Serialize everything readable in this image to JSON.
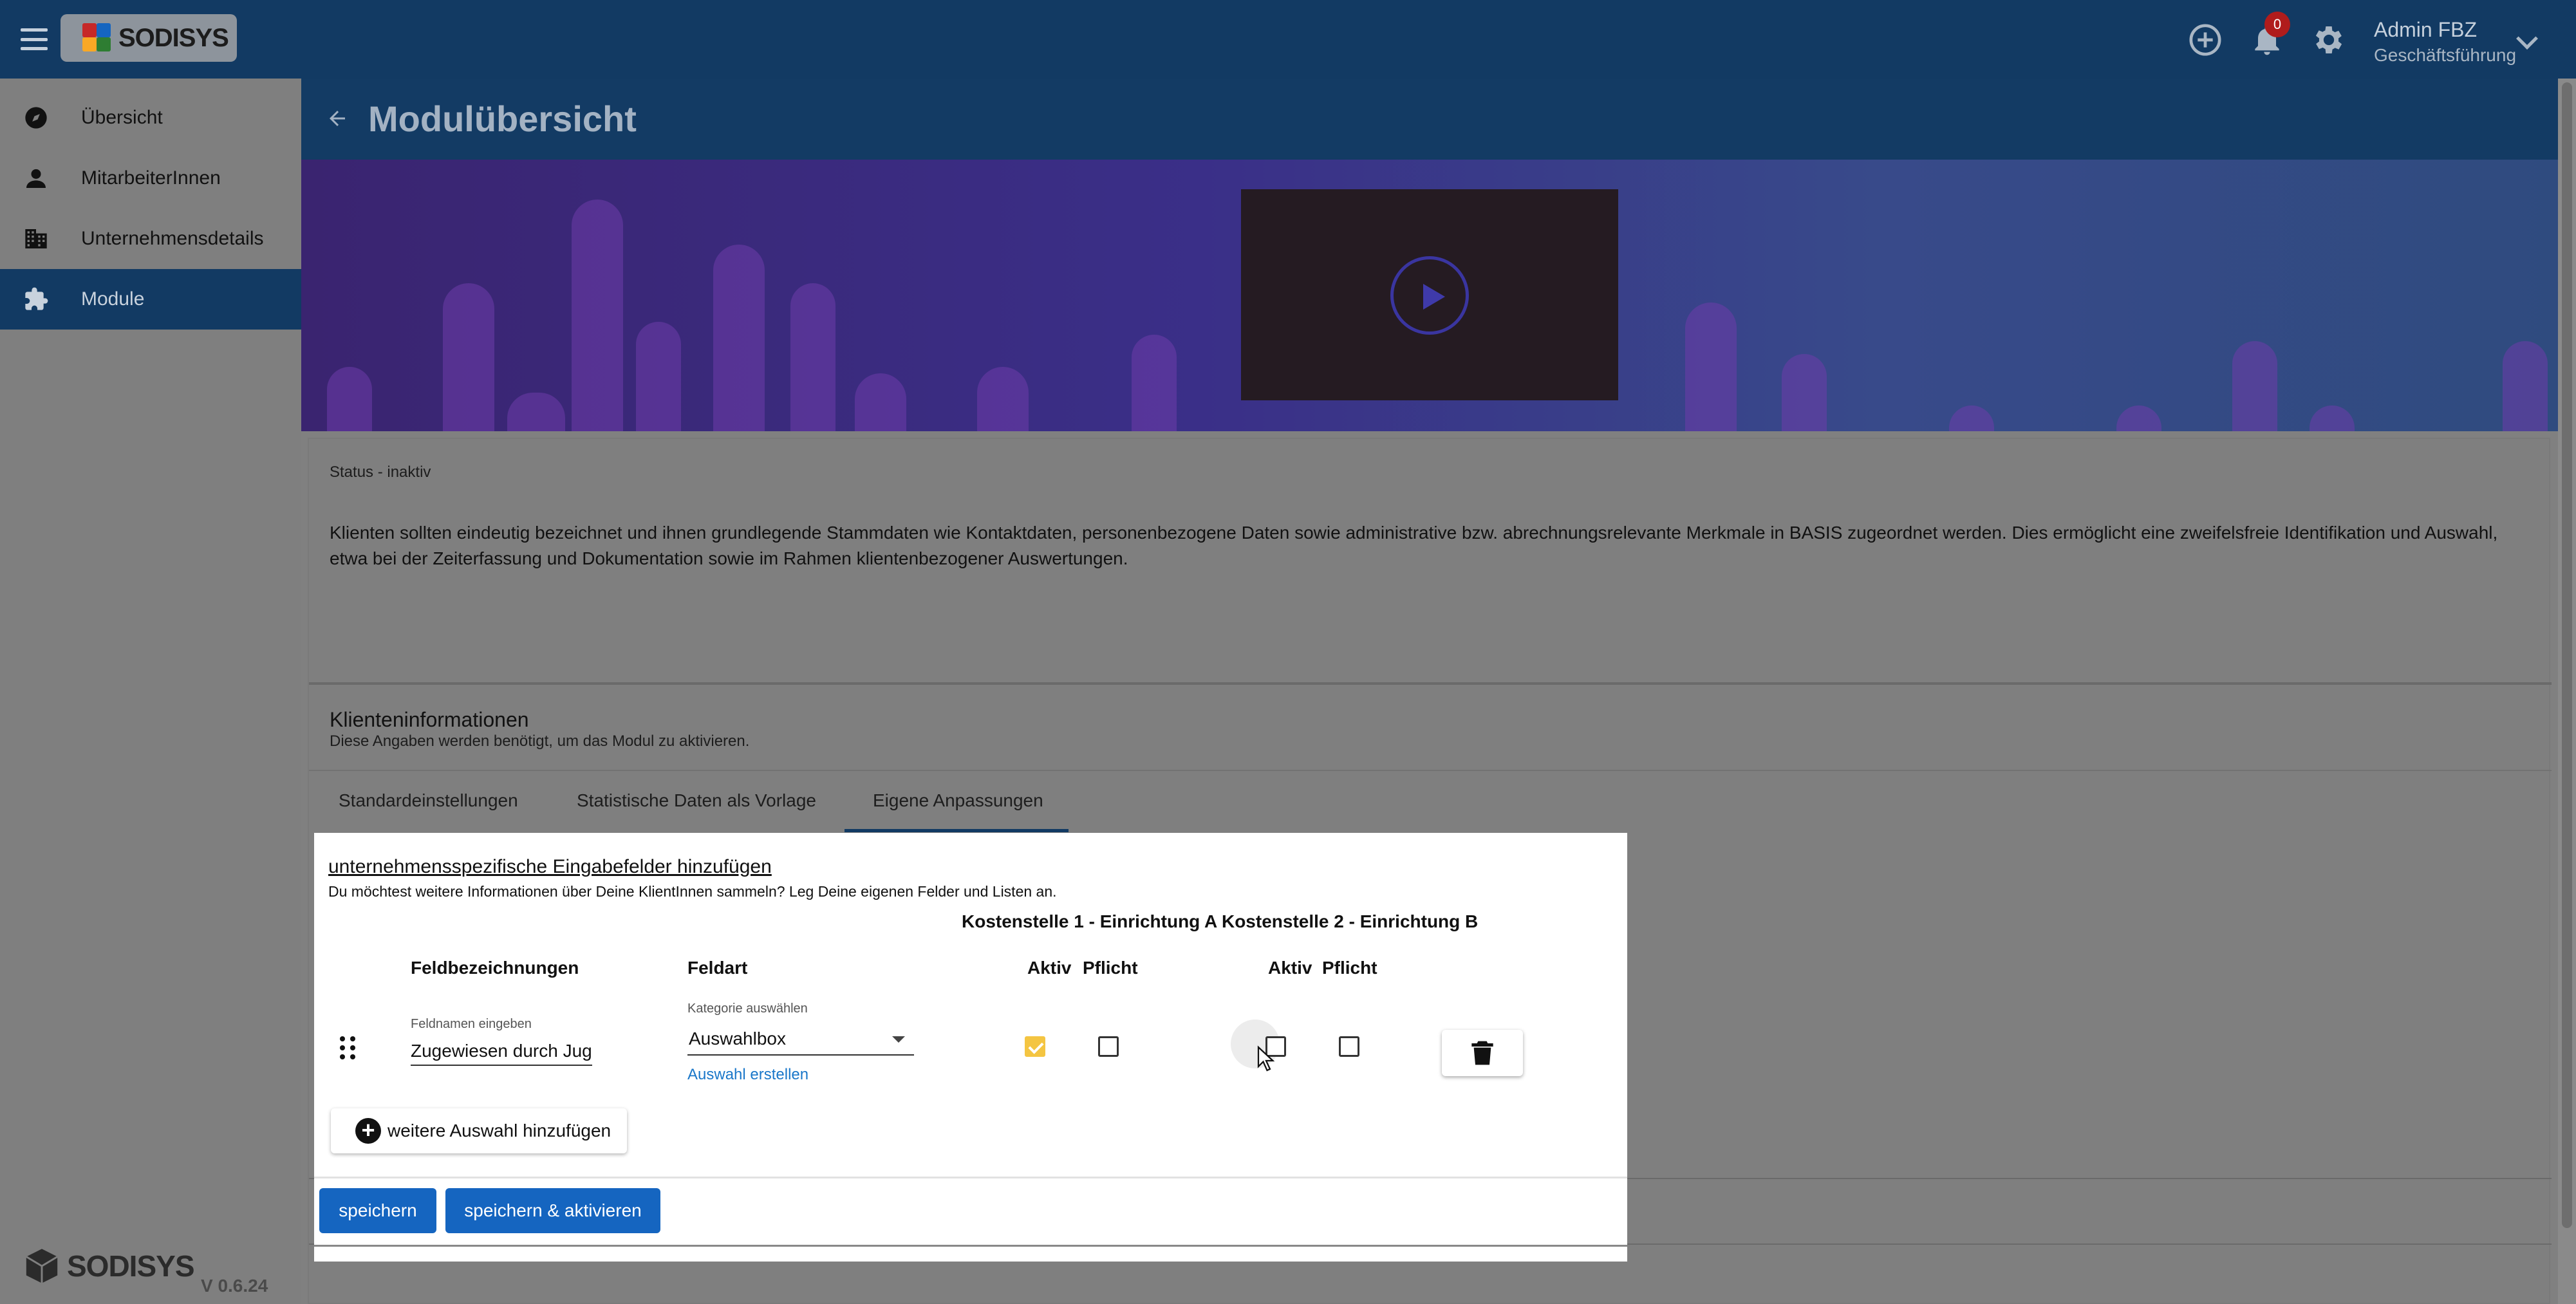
{
  "app": {
    "logo_text": "SODISYS",
    "version": "V 0.6.24",
    "notifications_count": "0"
  },
  "user": {
    "name": "Admin FBZ",
    "role": "Geschäftsführung"
  },
  "sidebar": {
    "items": [
      {
        "label": "Übersicht",
        "icon": "compass-icon",
        "active": false
      },
      {
        "label": "MitarbeiterInnen",
        "icon": "person-icon",
        "active": false
      },
      {
        "label": "Unternehmensdetails",
        "icon": "building-icon",
        "active": false
      },
      {
        "label": "Module",
        "icon": "puzzle-icon",
        "active": true
      }
    ]
  },
  "page": {
    "title": "Modulübersicht",
    "status": "Status - inaktiv",
    "description": "Klienten sollten eindeutig bezeichnet und ihnen grundlegende Stammdaten wie Kontaktdaten, personenbezogene Daten sowie administrative bzw. abrechnungsrelevante Merkmale in BASIS zugeordnet werden. Dies ermöglicht eine zweifelsfreie Identifikation und Auswahl, etwa bei der Zeiterfassung und Dokumentation sowie im Rahmen klientenbezogener Auswertungen.",
    "section_title": "Klienteninformationen",
    "section_subtitle": "Diese Angaben werden benötigt, um das Modul zu aktivieren.",
    "tabs": [
      {
        "label": "Standardeinstellungen",
        "active": false
      },
      {
        "label": "Statistische Daten als Vorlage",
        "active": false
      },
      {
        "label": "Eigene Anpassungen",
        "active": true
      }
    ]
  },
  "dialog": {
    "link": "unternehmensspezifische Eingabefelder hinzufügen",
    "description": "Du möchtest weitere Informationen über Deine KlientInnen sammeln? Leg Deine eigenen Felder und Listen an.",
    "cost_centers_header": "Kostenstelle 1 - Einrichtung A Kostenstelle 2 - Einrichtung B",
    "columns": {
      "field_names": "Feldbezeichnungen",
      "field_type": "Feldart",
      "active_1": "Aktiv",
      "required_1": "Pflicht",
      "active_2": "Aktiv",
      "required_2": "Pflicht"
    },
    "row": {
      "name_label": "Feldnamen eingeben",
      "name_value": "Zugewiesen durch Jugendamt",
      "type_label": "Kategorie auswählen",
      "type_value": "Auswahlbox",
      "create_choice_link": "Auswahl erstellen",
      "active_1": true,
      "required_1": false,
      "active_2": false,
      "required_2": false
    },
    "add_button": "weitere Auswahl hinzufügen",
    "save_button": "speichern",
    "save_activate_button": "speichern & aktivieren"
  },
  "colors": {
    "header_bg": "#123a63",
    "primary_button": "#1565c0",
    "checkbox_checked": "#f4c542",
    "link_blue": "#1a77c9",
    "badge_red": "#b01c1c"
  }
}
